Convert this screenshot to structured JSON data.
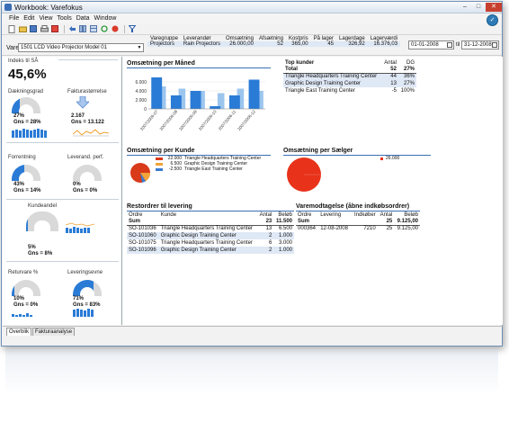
{
  "window": {
    "title": "Workbook: Varefokus",
    "min": "–",
    "max": "□",
    "close": "✕"
  },
  "menu": [
    "File",
    "Edit",
    "View",
    "Tools",
    "Data",
    "Window"
  ],
  "filter": {
    "vare_label": "Vare",
    "vare_value": "1501 LCD Video Projector Model 01",
    "info_headers": [
      "Varegruppe",
      "Leverandør",
      "Omsætning",
      "Afsætning",
      "Kostpris",
      "På lager",
      "Lagerdage",
      "Lagerværdi"
    ],
    "info_values": [
      "Projectors",
      "Rain Projectors",
      "26.000,00",
      "52",
      "365,00",
      "45",
      "326,92",
      "16.376,03"
    ],
    "date_from": "01-01-2008",
    "til_label": "til",
    "date_to": "31-12-2008"
  },
  "kpi": {
    "index_label": "Indeks til SÅ",
    "index_value": "45,6%",
    "daekningsgrad_label": "Dækningsgrad",
    "daekningsgrad_value": "27%",
    "daekningsgrad_gns": "Gns = 28%",
    "fakturastorrelse_label": "Fakturastørrelse",
    "fakturastorrelse_value": "2.167",
    "fakturastorrelse_gns": "Gns = 13.122",
    "forrentning_label": "Forrentning",
    "forrentning_value": "43%",
    "forrentning_gns": "Gns = 14%",
    "leverand_label": "Leverand. perf.",
    "leverand_value": "0%",
    "leverand_gns": "Gns = 0%",
    "kundeandel_label": "Kundeandel",
    "kundeandel_value": "5%",
    "kundeandel_gns": "Gns = 8%",
    "returvare_label": "Returvare %",
    "returvare_value": "10%",
    "returvare_gns": "Gns = 0%",
    "leveringsevne_label": "Leveringsevne",
    "leveringsevne_value": "71%",
    "leveringsevne_gns": "Gns = 83%",
    "daekningsgrad_fill": 0.27,
    "forrentning_fill": 0.43,
    "kundeandel_fill": 0.05,
    "returvare_fill": 0.1,
    "leveringsevne_fill": 0.71
  },
  "omsaetning_per_maaned": {
    "title": "Omsætning per Måned"
  },
  "chart_data": [
    {
      "type": "bar",
      "title": "Omsætning per Måned",
      "categories": [
        "2007/2006-07",
        "2007/2006-08",
        "2007/2006-09",
        "2007/2006-10",
        "2007/2006-11",
        "2007/2006-12"
      ],
      "values": [
        7000,
        3000,
        4000,
        600,
        3000,
        6500
      ],
      "series_prior": [
        5000,
        4500,
        4000,
        3500,
        4500,
        4000
      ],
      "ylim": [
        0,
        8000
      ],
      "yticks": [
        "0",
        "2.000",
        "4.000",
        "6.000"
      ],
      "colors": {
        "current": "#2a7bd6",
        "prior": "#9cc5ee"
      }
    },
    {
      "type": "pie",
      "title": "Omsætning per Kunde",
      "slices": [
        {
          "label": "Triangle Headquarters Training Center",
          "value": 22000,
          "color": "#d83a1a"
        },
        {
          "label": "Graphic Design Training Center",
          "value": 6500,
          "color": "#f2a33a"
        },
        {
          "label": "Triangle East Training Center",
          "value": -2500,
          "color": "#3a7ad1"
        }
      ]
    },
    {
      "type": "pie",
      "title": "Omsætning per Sælger",
      "slices": [
        {
          "label": "",
          "value": 26000,
          "color": "#e8321a"
        }
      ]
    }
  ],
  "kunde_legend": [
    {
      "value": "22.000",
      "label": "Triangle Headquarters Training Center",
      "color": "#d83a1a"
    },
    {
      "value": "6.500",
      "label": "Graphic Design Training Center",
      "color": "#f2a33a"
    },
    {
      "value": "-2.500",
      "label": "Triangle East Training Center",
      "color": "#3a7ad1"
    }
  ],
  "saelger_legend": {
    "value": "26.000",
    "color": "#e8321a"
  },
  "omsaetning_kunde_title": "Omsætning per Kunde",
  "omsaetning_saelger_title": "Omsætning per Sælger",
  "top_kunder": {
    "title": "Top kunder",
    "headers": [
      "",
      "Antal",
      "DG"
    ],
    "total": [
      "Total",
      "52",
      "27%"
    ],
    "rows": [
      [
        "Triangle Headquarters Training Center",
        "44",
        "36%"
      ],
      [
        "Graphic Design Training Center",
        "13",
        "27%"
      ],
      [
        "Triangle East Training Center",
        "-5",
        "100%"
      ]
    ]
  },
  "restordrer": {
    "title": "Restordrer til levering",
    "headers": [
      "Ordre",
      "Kunde",
      "Antal",
      "Beløb"
    ],
    "sum": [
      "Sum",
      "",
      "23",
      "11.500"
    ],
    "rows": [
      [
        "SO-101036",
        "Triangle Headquarters Training Center",
        "13",
        "6.500"
      ],
      [
        "SO-101060",
        "Graphic Design Training Center",
        "2",
        "1.000"
      ],
      [
        "SO-101075",
        "Triangle Headquarters Training Center",
        "6",
        "3.000"
      ],
      [
        "SO-101096",
        "Graphic Design Training Center",
        "2",
        "1.000"
      ]
    ]
  },
  "varemodtagelse": {
    "title": "Varemodtagelse (åbne indkøbsordrer)",
    "headers": [
      "Ordre",
      "Levering",
      "Indkøber",
      "Antal",
      "Beløb"
    ],
    "sum": [
      "Sum",
      "",
      "",
      "25",
      "9.125,00"
    ],
    "rows": [
      [
        "000364",
        "12-08-2008",
        "7210",
        "25",
        "9.125,00"
      ]
    ]
  },
  "tabs": [
    "Overblik",
    "Fakturaanalyse"
  ]
}
